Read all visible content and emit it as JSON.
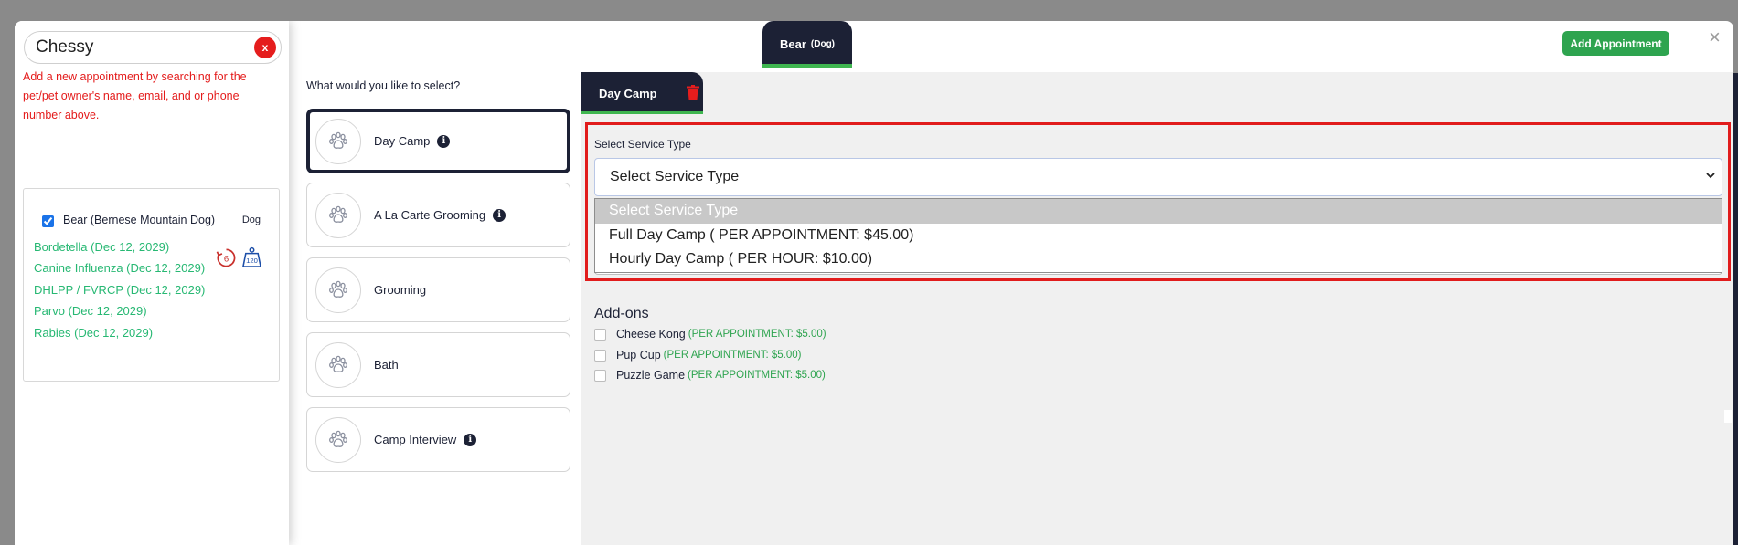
{
  "search": {
    "value": "Chessy",
    "clear_label": "x"
  },
  "hint_text": "Add a new appointment by searching for the pet/pet owner's name, email, and or phone number above.",
  "pet_card": {
    "name": "Bear (Bernese Mountain Dog)",
    "type": "Dog",
    "checked": true,
    "badge_count": "6",
    "badge_weight": "120",
    "vaccinations": [
      "Bordetella (Dec 12, 2029)",
      "Canine Influenza (Dec 12, 2029)",
      "DHLPP / FVRCP (Dec 12, 2029)",
      "Parvo (Dec 12, 2029)",
      "Rabies (Dec 12, 2029)"
    ]
  },
  "services": {
    "title": "What would you like to select?",
    "items": [
      {
        "label": "Day Camp",
        "info": true,
        "active": true
      },
      {
        "label": "A La Carte Grooming",
        "info": true,
        "active": false
      },
      {
        "label": "Grooming",
        "info": false,
        "active": false
      },
      {
        "label": "Bath",
        "info": false,
        "active": false
      },
      {
        "label": "Camp Interview",
        "info": true,
        "active": false
      }
    ]
  },
  "pet_tab": {
    "name": "Bear",
    "type": "(Dog)"
  },
  "add_appointment_label": "Add Appointment",
  "close_label": "×",
  "service_tab": {
    "label": "Day Camp"
  },
  "service_type": {
    "label": "Select Service Type",
    "selected": "Select Service Type",
    "options": [
      "Select Service Type",
      "Full Day Camp ( PER APPOINTMENT: $45.00)",
      "Hourly Day Camp ( PER HOUR: $10.00)"
    ]
  },
  "addons": {
    "title": "Add-ons",
    "items": [
      {
        "name": "Cheese Kong",
        "price": "(PER APPOINTMENT: $5.00)"
      },
      {
        "name": "Pup Cup",
        "price": "(PER APPOINTMENT: $5.00)"
      },
      {
        "name": "Puzzle Game",
        "price": "(PER APPOINTMENT: $5.00)"
      }
    ]
  },
  "colors": {
    "navy": "#1c2135",
    "accent_green": "#2ea44f",
    "vaccine_green": "#27b873",
    "alert_red": "#e11c1c"
  }
}
